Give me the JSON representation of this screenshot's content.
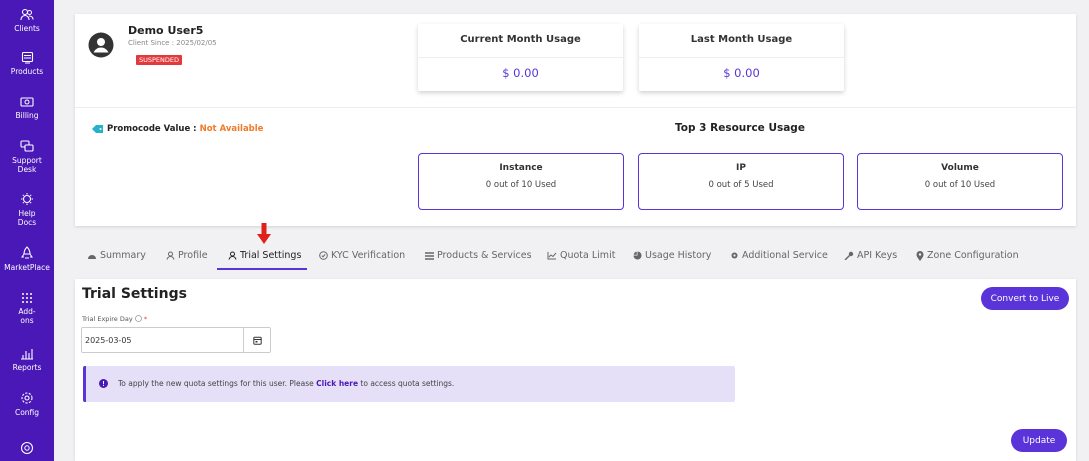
{
  "sidebar": {
    "items": [
      {
        "label": "Clients",
        "icon": "users-icon"
      },
      {
        "label": "Products",
        "icon": "server-icon"
      },
      {
        "label": "Billing",
        "icon": "money-icon"
      },
      {
        "label": "Support Desk",
        "icon": "chat-icon"
      },
      {
        "label": "Help Docs",
        "icon": "lightbulb-icon"
      },
      {
        "label": "MarketPlace",
        "icon": "rocket-icon"
      },
      {
        "label": "Add-ons",
        "icon": "grid-icon"
      },
      {
        "label": "Reports",
        "icon": "bar-chart-icon"
      },
      {
        "label": "Config",
        "icon": "gear-icon"
      },
      {
        "label": "",
        "icon": "help-circle-icon"
      }
    ]
  },
  "user": {
    "name": "Demo User5",
    "client_since": "Client Since : 2025/02/05",
    "status": "SUSPENDED"
  },
  "usage": {
    "current_month": {
      "title": "Current Month Usage",
      "value": "$ 0.00"
    },
    "last_month": {
      "title": "Last Month Usage",
      "value": "$ 0.00"
    }
  },
  "promo": {
    "label": "Promocode Value :",
    "value": "Not Available"
  },
  "resources": {
    "title": "Top 3 Resource Usage",
    "items": [
      {
        "title": "Instance",
        "value": "0 out of 10 Used"
      },
      {
        "title": "IP",
        "value": "0 out of 5 Used"
      },
      {
        "title": "Volume",
        "value": "0 out of 10 Used"
      }
    ]
  },
  "tabs": [
    {
      "label": "Summary"
    },
    {
      "label": "Profile"
    },
    {
      "label": "Trial Settings"
    },
    {
      "label": "KYC Verification"
    },
    {
      "label": "Products & Services"
    },
    {
      "label": "Quota Limit"
    },
    {
      "label": "Usage History"
    },
    {
      "label": "Additional Service"
    },
    {
      "label": "API Keys"
    },
    {
      "label": "Zone Configuration"
    }
  ],
  "active_tab": "Trial Settings",
  "trial": {
    "title": "Trial Settings",
    "field_label": "Trial Expire Day",
    "required_mark": "*",
    "date_value": "2025-03-05",
    "info_text_before": "To apply the new quota settings for this user. Please ",
    "info_link": "Click here",
    "info_text_after": " to access quota settings.",
    "convert_button": "Convert to Live",
    "update_button": "Update"
  },
  "colors": {
    "sidebar": "#4a18b6",
    "accent": "#5a34d8",
    "danger": "#e23a3a",
    "promo_value": "#f07a2a",
    "info_bg": "#e5dff8"
  }
}
